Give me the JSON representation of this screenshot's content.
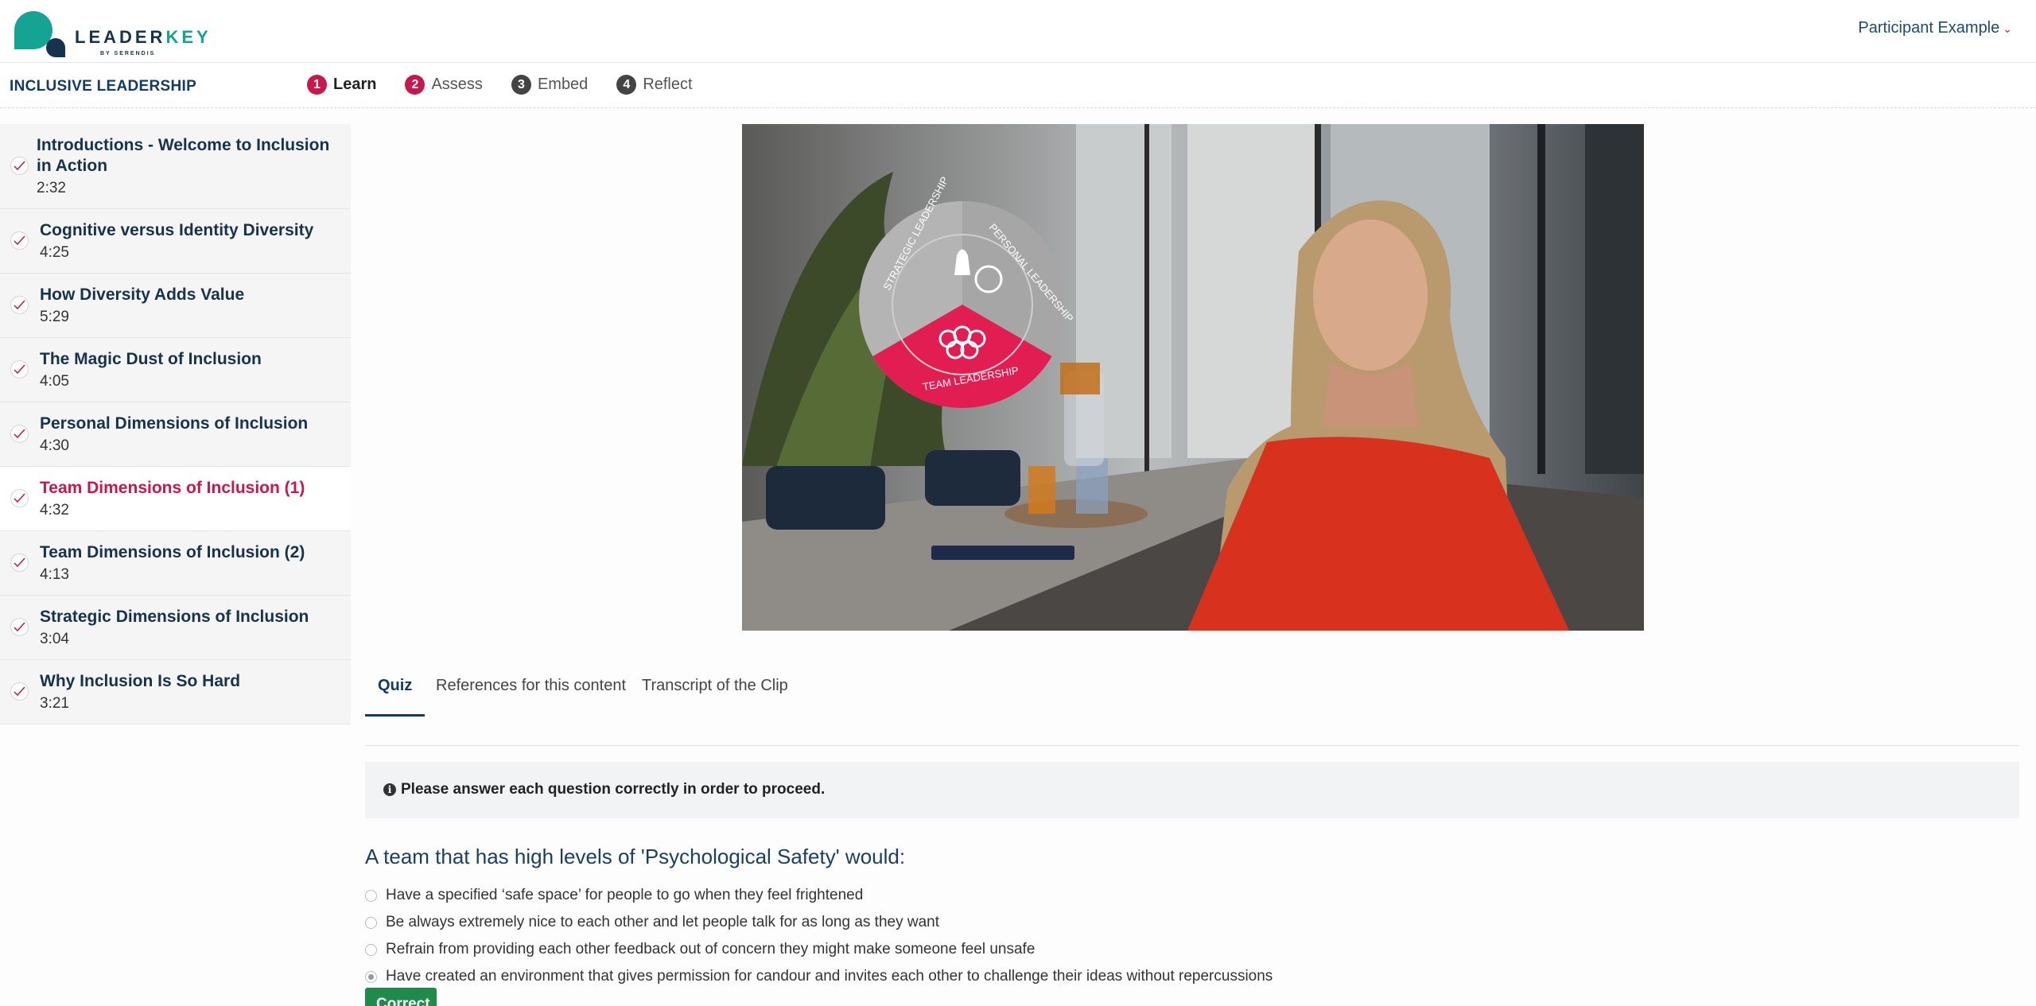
{
  "header": {
    "logo_main": "LEADER",
    "logo_key": "KEY",
    "logo_sub": "BY SERENDIS",
    "user_menu_label": "Participant Example"
  },
  "subnav": {
    "course_title": "INCLUSIVE LEADERSHIP",
    "steps": [
      {
        "num": "1",
        "label": "Learn",
        "active": true
      },
      {
        "num": "2",
        "label": "Assess"
      },
      {
        "num": "3",
        "label": "Embed"
      },
      {
        "num": "4",
        "label": "Reflect"
      }
    ]
  },
  "sidebar": {
    "lessons": [
      {
        "title": "Introductions - Welcome to Inclusion in Action",
        "duration": "2:32"
      },
      {
        "title": "Cognitive versus Identity Diversity",
        "duration": "4:25"
      },
      {
        "title": "How Diversity Adds Value",
        "duration": "5:29"
      },
      {
        "title": "The Magic Dust of Inclusion",
        "duration": "4:05"
      },
      {
        "title": "Personal Dimensions of Inclusion",
        "duration": "4:30"
      },
      {
        "title": "Team Dimensions of Inclusion (1)",
        "duration": "4:32",
        "current": true
      },
      {
        "title": "Team Dimensions of Inclusion (2)",
        "duration": "4:13"
      },
      {
        "title": "Strategic Dimensions of Inclusion",
        "duration": "3:04"
      },
      {
        "title": "Why Inclusion Is So Hard",
        "duration": "3:21"
      }
    ]
  },
  "video": {
    "wheel_labels": {
      "strategic": "STRATEGIC LEADERSHIP",
      "personal": "PERSONAL LEADERSHIP",
      "team": "TEAM LEADERSHIP"
    }
  },
  "tabs": [
    "Quiz",
    "References for this content",
    "Transcript of the Clip"
  ],
  "alert": {
    "text": "Please answer each question correctly in order to proceed."
  },
  "quiz": {
    "question": "A team that has high levels of 'Psychological Safety' would:",
    "options": [
      "Have a specified ‘safe space’ for people to go when they feel frightened",
      "Be always extremely nice to each other and let people talk for as long as they want",
      "Refrain from providing each other feedback out of concern they might make someone feel unsafe",
      "Have created an environment that gives permission for candour and invites each other to challenge their ideas without repercussions"
    ],
    "selected_index": 3,
    "button_label": "Correct"
  },
  "colors": {
    "brand_navy": "#17324d",
    "brand_teal": "#15a394",
    "accent_red": "#c8174a",
    "success_green": "#1f8a4c"
  }
}
